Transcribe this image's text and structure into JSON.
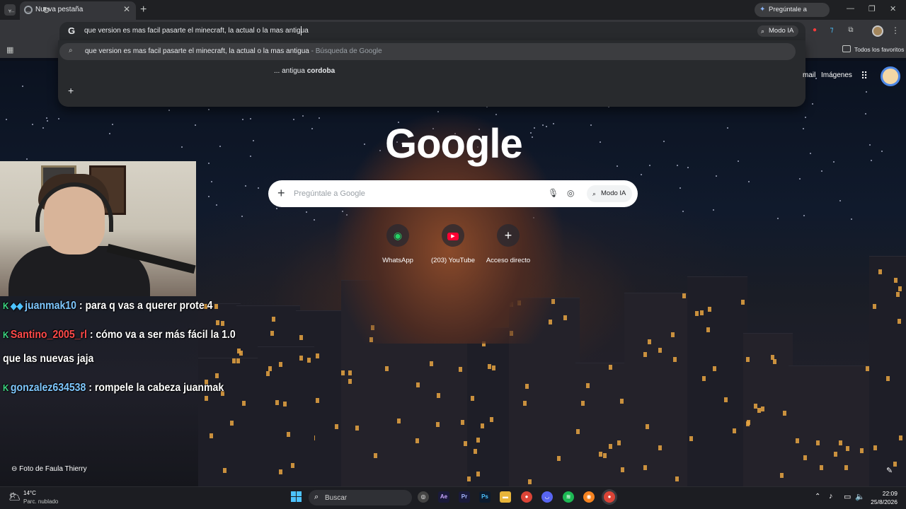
{
  "tabbar": {
    "tab_title": "Nueva pestaña",
    "gemini_label": "Pregúntale a Gemini"
  },
  "toolbar": {
    "omnibox_text": "que version es mas facil pasarte el minecraft, la actual o la mas antigua",
    "modo_ia_label": "Modo IA"
  },
  "bookmarks": {
    "all_bookmarks_label": "Todos los favoritos"
  },
  "dropdown": {
    "suggestion_1_query": "que version es mas facil pasarte el minecraft, la actual o la mas antigua",
    "suggestion_1_separator": "-",
    "suggestion_1_source": "Búsqueda de Google",
    "suggestion_2_prefix": "... antigua",
    "suggestion_2_bold": "cordoba"
  },
  "ntp": {
    "gmail_label": "mail",
    "images_label": "Imágenes",
    "logo_text": "Google",
    "search_placeholder": "Pregúntale a Google",
    "modo_ia_label": "Modo IA",
    "shortcuts": [
      {
        "label": "WhatsApp",
        "icon": "whatsapp-icon"
      },
      {
        "label": "(203) YouTube",
        "icon": "youtube-icon"
      },
      {
        "label": "Acceso directo",
        "icon": "plus-icon"
      }
    ],
    "photo_credit": "Foto de Faula Thierry"
  },
  "chat": [
    {
      "user": "juanmak10",
      "message": ": para q vas a querer prote 4",
      "user_color": "#7fc8ff"
    },
    {
      "user": "Santino_2005_rl",
      "message": ": cómo va a ser más fácil la 1.0",
      "user_color": "#ff4a4a"
    },
    {
      "continuation": "que las nuevas jaja"
    },
    {
      "user": "gonzalez634538",
      "message": ": rompele la cabeza juanmak",
      "user_color": "#7fc8ff"
    }
  ],
  "taskbar": {
    "weather_temp": "14°C",
    "weather_desc": "Parc. nublado",
    "search_label": "Buscar",
    "clock_time": "22:09",
    "clock_date": "25/8/2026"
  },
  "colors": {
    "accent_blue": "#8ab4f8",
    "chrome_dark": "#35363a",
    "windows_blue": "#4cc2ff"
  }
}
